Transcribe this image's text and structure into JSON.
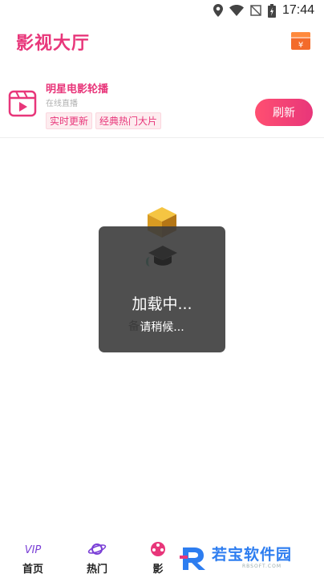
{
  "status_bar": {
    "time": "17:44"
  },
  "header": {
    "title": "影视大厅",
    "gift_symbol": "¥"
  },
  "banner": {
    "title": "明星电影轮播",
    "subtitle": "在线直播",
    "tags": [
      "实时更新",
      "经典热门大片"
    ],
    "refresh_label": "刷新"
  },
  "loading": {
    "title": "加载中...",
    "subtitle": "请稍候...",
    "behind_text": "备"
  },
  "bottom_nav": {
    "items": [
      {
        "label": "首页",
        "icon": "vip-icon"
      },
      {
        "label": "热门",
        "icon": "planet-icon"
      },
      {
        "label": "影",
        "icon": "film-reel-icon"
      }
    ]
  },
  "watermark": {
    "text": "若宝软件园",
    "url": "RBSOFT.COM"
  },
  "colors": {
    "accent": "#e8367a",
    "refresh_start": "#ff4f71",
    "watermark": "#2d7df0"
  }
}
